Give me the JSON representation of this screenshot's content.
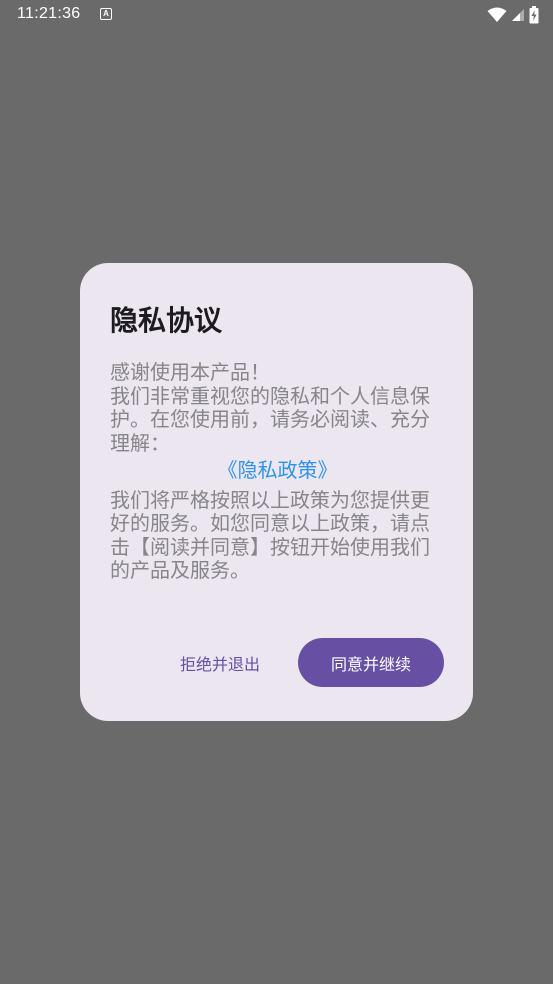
{
  "status_bar": {
    "time": "11:21:36",
    "notification_icon": "A"
  },
  "dialog": {
    "title": "隐私协议",
    "intro_thanks": "感谢使用本产品！",
    "intro_text": "我们非常重视您的隐私和个人信息保护。在您使用前，请务必阅读、充分理解：",
    "policy_link": "《隐私政策》",
    "closing_text": "我们将严格按照以上政策为您提供更好的服务。如您同意以上政策，请点击【阅读并同意】按钮开始使用我们的产品及服务。",
    "reject_label": "拒绝并退出",
    "accept_label": "同意并继续"
  },
  "colors": {
    "backdrop": "#6a6a6a",
    "dialog_bg": "#ebe6ef",
    "primary": "#6750a4",
    "link": "#2f93e7",
    "body_text": "#878589"
  }
}
